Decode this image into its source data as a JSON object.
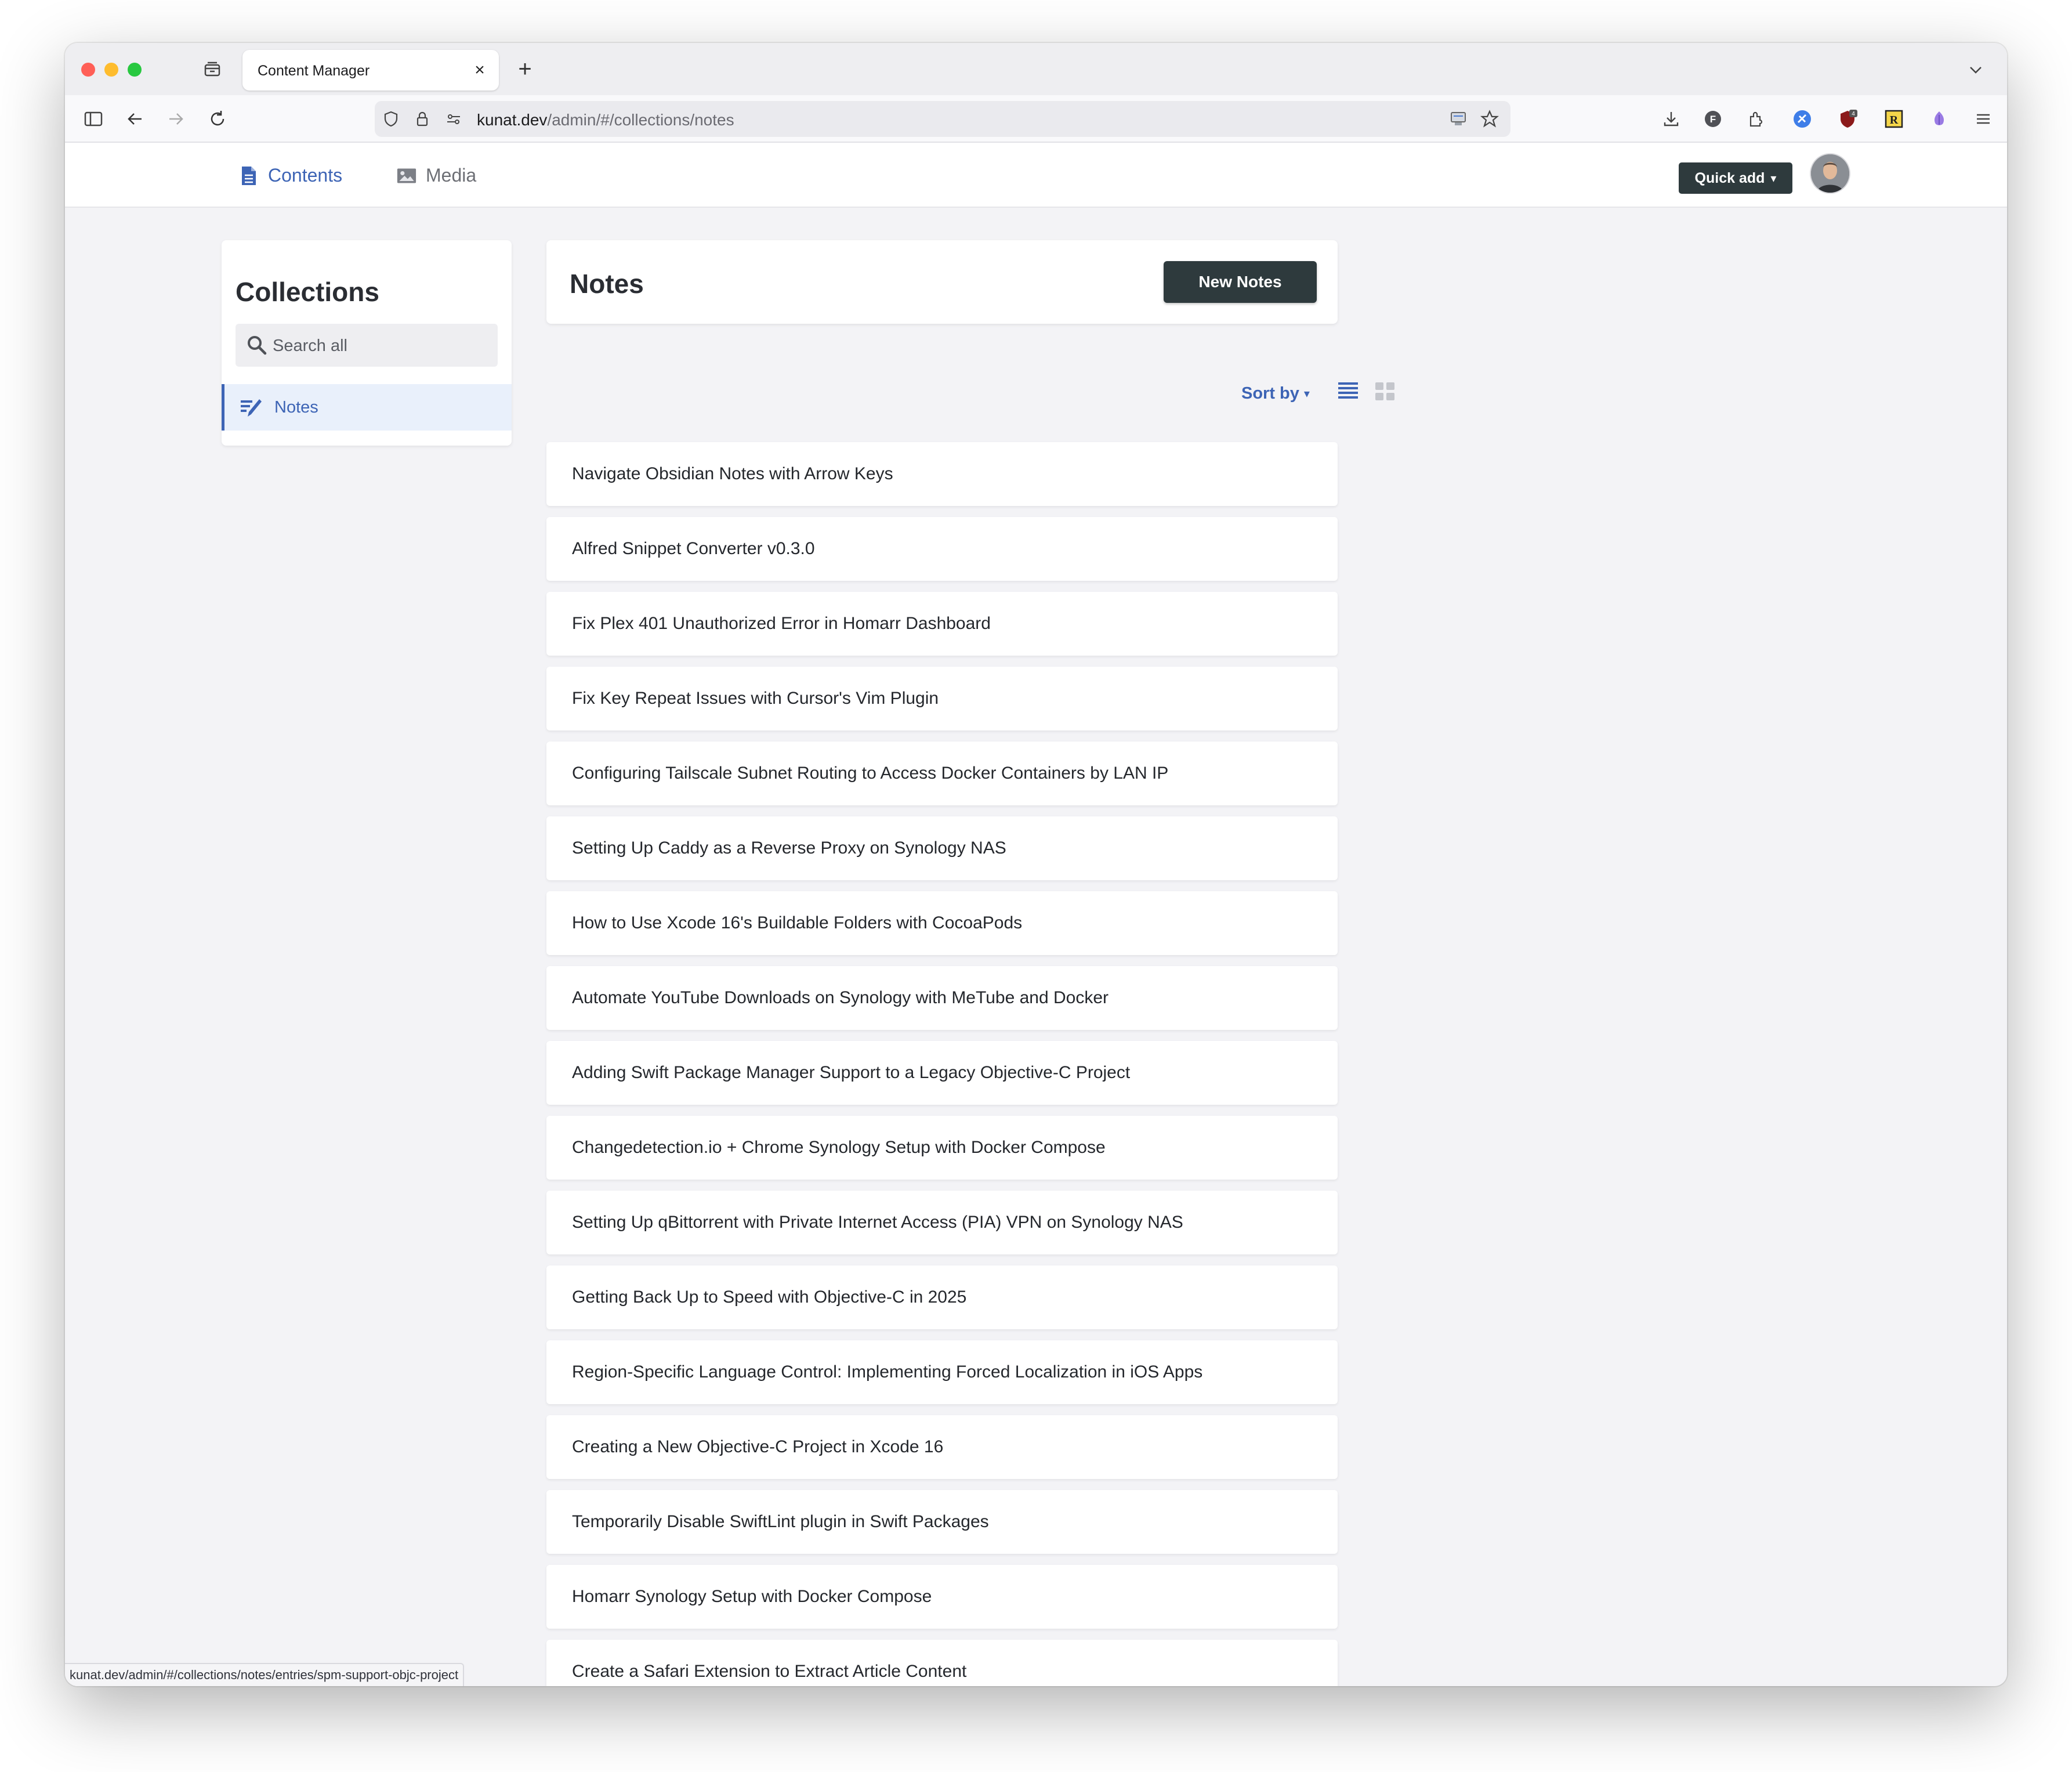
{
  "browser": {
    "tab_title": "Content Manager",
    "tab_close": "×",
    "new_tab": "+",
    "url_host": "kunat.dev",
    "url_path": "/admin/#/collections/notes",
    "status_url": "kunat.dev/admin/#/collections/notes/entries/spm-support-objc-project",
    "extension_badge": "4"
  },
  "header": {
    "nav": [
      {
        "label": "Contents",
        "icon": "document-icon"
      },
      {
        "label": "Media",
        "icon": "image-icon"
      }
    ],
    "quick_add": "Quick add",
    "caret": "▾"
  },
  "sidebar": {
    "title": "Collections",
    "search_placeholder": "Search all",
    "items": [
      {
        "label": "Notes",
        "icon": "write-icon"
      }
    ]
  },
  "main": {
    "title": "Notes",
    "new_button": "New Notes",
    "sort_label": "Sort by",
    "sort_caret": "▾",
    "notes": [
      "Navigate Obsidian Notes with Arrow Keys",
      "Alfred Snippet Converter v0.3.0",
      "Fix Plex 401 Unauthorized Error in Homarr Dashboard",
      "Fix Key Repeat Issues with Cursor's Vim Plugin",
      "Configuring Tailscale Subnet Routing to Access Docker Containers by LAN IP",
      "Setting Up Caddy as a Reverse Proxy on Synology NAS",
      "How to Use Xcode 16's Buildable Folders with CocoaPods",
      "Automate YouTube Downloads on Synology with MeTube and Docker",
      "Adding Swift Package Manager Support to a Legacy Objective-C Project",
      "Changedetection.io + Chrome Synology Setup with Docker Compose",
      "Setting Up qBittorrent with Private Internet Access (PIA) VPN on Synology NAS",
      "Getting Back Up to Speed with Objective-C in 2025",
      "Region-Specific Language Control: Implementing Forced Localization in iOS Apps",
      "Creating a New Objective-C Project in Xcode 16",
      "Temporarily Disable SwiftLint plugin in Swift Packages",
      "Homarr Synology Setup with Docker Compose",
      "Create a Safari Extension to Extract Article Content",
      ""
    ]
  },
  "colors": {
    "accent": "#3d64b5",
    "dark_button": "#2e3a3d",
    "page_bg": "#f3f3f6"
  }
}
